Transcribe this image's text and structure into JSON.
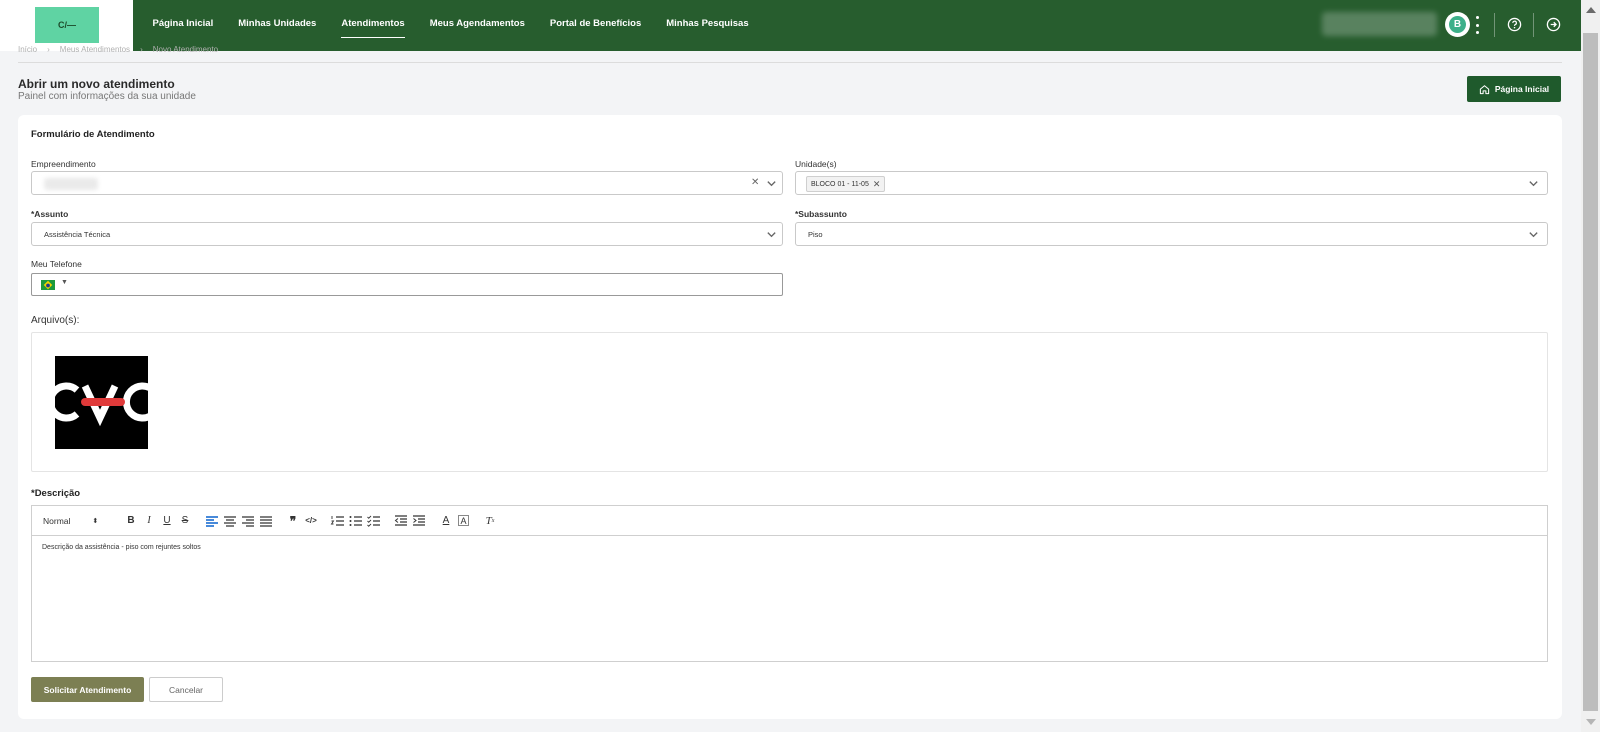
{
  "logo": {
    "text": "C/—"
  },
  "nav": {
    "items": [
      {
        "label": "Página Inicial"
      },
      {
        "label": "Minhas Unidades"
      },
      {
        "label": "Atendimentos"
      },
      {
        "label": "Meus Agendamentos"
      },
      {
        "label": "Portal de Benefícios"
      },
      {
        "label": "Minhas Pesquisas"
      }
    ],
    "active": "Atendimentos"
  },
  "user": {
    "avatar_initial": "B"
  },
  "breadcrumb": [
    "Início",
    "Meus Atendimentos",
    "Novo Atendimento"
  ],
  "header": {
    "title": "Abrir um novo atendimento",
    "subtitle": "Painel com informações da sua unidade",
    "home_button": "Página Inicial"
  },
  "form": {
    "title": "Formulário de Atendimento",
    "empreendimento": {
      "label": "Empreendimento"
    },
    "unidades": {
      "label": "Unidade(s)",
      "tag": "BLOCO 01 - 11-05"
    },
    "assunto": {
      "label": "*Assunto",
      "value": "Assistência Técnica"
    },
    "subassunto": {
      "label": "*Subassunto",
      "value": "Piso"
    },
    "telefone": {
      "label": "Meu Telefone",
      "value": ""
    },
    "arquivos": {
      "label": "Arquivo(s):"
    },
    "descricao": {
      "label": "*Descrição",
      "format": "Normal",
      "text": "Descrição da assistência - piso com rejuntes soltos"
    },
    "submit_label": "Solicitar Atendimento",
    "cancel_label": "Cancelar"
  },
  "colors": {
    "header_green": "#275d2e",
    "primary_button": "#1f5a2c",
    "submit_button": "#7c7f53"
  }
}
